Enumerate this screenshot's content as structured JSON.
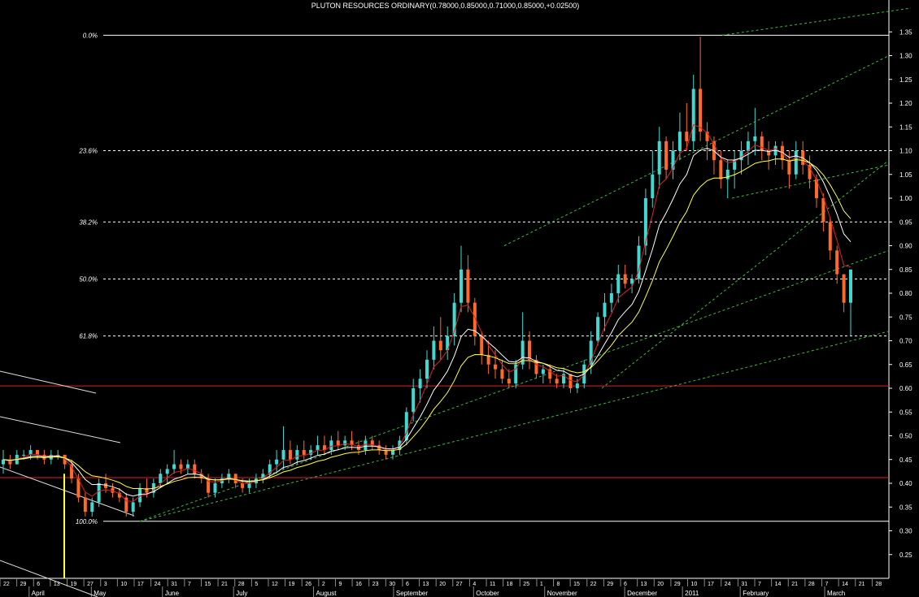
{
  "chart_data": {
    "type": "candlestick",
    "title": "PLUTON RESOURCES  ORDINARY(0.78000,0.85000,0.71000,0.85000,+0.02500)",
    "y_axis": {
      "min": 0.2,
      "max": 1.4,
      "position": "right",
      "ticks": [
        "0.25",
        "0.30",
        "0.35",
        "0.40",
        "0.45",
        "0.50",
        "0.55",
        "0.60",
        "0.65",
        "0.70",
        "0.75",
        "0.80",
        "0.85",
        "0.90",
        "0.95",
        "1.00",
        "1.05",
        "1.10",
        "1.15",
        "1.20",
        "1.25",
        "1.30",
        "1.35"
      ]
    },
    "x_axis": {
      "day_ticks": [
        "22",
        "29",
        "6",
        "13",
        "19",
        "27",
        "3",
        "10",
        "17",
        "24",
        "31",
        "7",
        "15",
        "21",
        "28",
        "5",
        "12",
        "19",
        "26",
        "2",
        "9",
        "16",
        "23",
        "30",
        "6",
        "13",
        "20",
        "27",
        "4",
        "11",
        "18",
        "25",
        "1",
        "8",
        "15",
        "22",
        "29",
        "6",
        "13",
        "20",
        "29",
        "10",
        "17",
        "24",
        "31",
        "7",
        "14",
        "21",
        "28",
        "7",
        "14",
        "21",
        "28"
      ],
      "months": [
        "April",
        "May",
        "June",
        "July",
        "August",
        "September",
        "October",
        "November",
        "December",
        "2011",
        "February",
        "March"
      ]
    },
    "fibonacci": [
      {
        "label": "0.0%",
        "price": 1.343
      },
      {
        "label": "23.6%",
        "price": 1.1
      },
      {
        "label": "38.2%",
        "price": 0.95
      },
      {
        "label": "50.0%",
        "price": 0.83
      },
      {
        "label": "61.8%",
        "price": 0.71
      },
      {
        "label": "100.0%",
        "price": 0.32
      }
    ],
    "horizontal_lines": [
      0.605,
      0.412
    ],
    "bars": [
      [
        0.44,
        0.47,
        0.42,
        0.45
      ],
      [
        0.45,
        0.46,
        0.43,
        0.44
      ],
      [
        0.44,
        0.47,
        0.44,
        0.46
      ],
      [
        0.46,
        0.47,
        0.45,
        0.46
      ],
      [
        0.46,
        0.48,
        0.45,
        0.47
      ],
      [
        0.47,
        0.47,
        0.45,
        0.46
      ],
      [
        0.46,
        0.47,
        0.44,
        0.45
      ],
      [
        0.45,
        0.47,
        0.44,
        0.46
      ],
      [
        0.46,
        0.47,
        0.45,
        0.46
      ],
      [
        0.46,
        0.46,
        0.43,
        0.44
      ],
      [
        0.44,
        0.45,
        0.4,
        0.41
      ],
      [
        0.41,
        0.42,
        0.36,
        0.37
      ],
      [
        0.37,
        0.38,
        0.33,
        0.34
      ],
      [
        0.34,
        0.37,
        0.33,
        0.36
      ],
      [
        0.36,
        0.41,
        0.35,
        0.4
      ],
      [
        0.4,
        0.42,
        0.38,
        0.39
      ],
      [
        0.39,
        0.4,
        0.37,
        0.38
      ],
      [
        0.38,
        0.39,
        0.36,
        0.37
      ],
      [
        0.37,
        0.38,
        0.33,
        0.34
      ],
      [
        0.34,
        0.37,
        0.33,
        0.36
      ],
      [
        0.36,
        0.4,
        0.35,
        0.39
      ],
      [
        0.39,
        0.41,
        0.37,
        0.38
      ],
      [
        0.38,
        0.41,
        0.37,
        0.4
      ],
      [
        0.4,
        0.43,
        0.39,
        0.42
      ],
      [
        0.42,
        0.44,
        0.4,
        0.43
      ],
      [
        0.43,
        0.47,
        0.42,
        0.44
      ],
      [
        0.44,
        0.45,
        0.42,
        0.43
      ],
      [
        0.43,
        0.45,
        0.42,
        0.44
      ],
      [
        0.44,
        0.45,
        0.41,
        0.42
      ],
      [
        0.42,
        0.43,
        0.4,
        0.41
      ],
      [
        0.41,
        0.42,
        0.37,
        0.38
      ],
      [
        0.38,
        0.41,
        0.37,
        0.4
      ],
      [
        0.4,
        0.42,
        0.39,
        0.41
      ],
      [
        0.41,
        0.43,
        0.4,
        0.42
      ],
      [
        0.42,
        0.42,
        0.39,
        0.4
      ],
      [
        0.4,
        0.41,
        0.38,
        0.39
      ],
      [
        0.39,
        0.41,
        0.38,
        0.4
      ],
      [
        0.4,
        0.42,
        0.39,
        0.41
      ],
      [
        0.41,
        0.43,
        0.4,
        0.42
      ],
      [
        0.42,
        0.45,
        0.41,
        0.44
      ],
      [
        0.44,
        0.47,
        0.42,
        0.45
      ],
      [
        0.45,
        0.52,
        0.43,
        0.47
      ],
      [
        0.47,
        0.49,
        0.44,
        0.45
      ],
      [
        0.45,
        0.48,
        0.44,
        0.47
      ],
      [
        0.47,
        0.49,
        0.45,
        0.46
      ],
      [
        0.46,
        0.48,
        0.45,
        0.47
      ],
      [
        0.47,
        0.5,
        0.46,
        0.48
      ],
      [
        0.48,
        0.5,
        0.46,
        0.47
      ],
      [
        0.47,
        0.5,
        0.46,
        0.49
      ],
      [
        0.49,
        0.51,
        0.47,
        0.48
      ],
      [
        0.48,
        0.5,
        0.47,
        0.49
      ],
      [
        0.49,
        0.51,
        0.47,
        0.48
      ],
      [
        0.48,
        0.49,
        0.46,
        0.47
      ],
      [
        0.47,
        0.5,
        0.46,
        0.49
      ],
      [
        0.49,
        0.5,
        0.47,
        0.48
      ],
      [
        0.48,
        0.49,
        0.46,
        0.47
      ],
      [
        0.47,
        0.48,
        0.45,
        0.46
      ],
      [
        0.46,
        0.48,
        0.45,
        0.47
      ],
      [
        0.47,
        0.5,
        0.46,
        0.49
      ],
      [
        0.49,
        0.56,
        0.48,
        0.55
      ],
      [
        0.55,
        0.62,
        0.53,
        0.6
      ],
      [
        0.6,
        0.64,
        0.57,
        0.62
      ],
      [
        0.62,
        0.68,
        0.6,
        0.66
      ],
      [
        0.66,
        0.73,
        0.64,
        0.7
      ],
      [
        0.7,
        0.75,
        0.66,
        0.68
      ],
      [
        0.68,
        0.73,
        0.66,
        0.71
      ],
      [
        0.71,
        0.8,
        0.69,
        0.78
      ],
      [
        0.78,
        0.9,
        0.76,
        0.85
      ],
      [
        0.85,
        0.88,
        0.76,
        0.78
      ],
      [
        0.78,
        0.79,
        0.69,
        0.71
      ],
      [
        0.71,
        0.72,
        0.65,
        0.67
      ],
      [
        0.67,
        0.7,
        0.63,
        0.65
      ],
      [
        0.65,
        0.68,
        0.62,
        0.64
      ],
      [
        0.64,
        0.66,
        0.61,
        0.62
      ],
      [
        0.62,
        0.64,
        0.6,
        0.61
      ],
      [
        0.61,
        0.66,
        0.6,
        0.65
      ],
      [
        0.65,
        0.76,
        0.64,
        0.7
      ],
      [
        0.7,
        0.72,
        0.64,
        0.66
      ],
      [
        0.66,
        0.67,
        0.62,
        0.63
      ],
      [
        0.63,
        0.65,
        0.61,
        0.64
      ],
      [
        0.64,
        0.65,
        0.61,
        0.62
      ],
      [
        0.62,
        0.63,
        0.6,
        0.61
      ],
      [
        0.61,
        0.64,
        0.6,
        0.63
      ],
      [
        0.63,
        0.63,
        0.59,
        0.6
      ],
      [
        0.6,
        0.62,
        0.59,
        0.61
      ],
      [
        0.61,
        0.66,
        0.6,
        0.65
      ],
      [
        0.65,
        0.72,
        0.63,
        0.7
      ],
      [
        0.7,
        0.76,
        0.69,
        0.75
      ],
      [
        0.75,
        0.8,
        0.72,
        0.78
      ],
      [
        0.78,
        0.82,
        0.76,
        0.8
      ],
      [
        0.8,
        0.86,
        0.78,
        0.84
      ],
      [
        0.84,
        0.86,
        0.81,
        0.82
      ],
      [
        0.82,
        0.84,
        0.8,
        0.83
      ],
      [
        0.83,
        0.92,
        0.82,
        0.9
      ],
      [
        0.9,
        1.02,
        0.88,
        1.0
      ],
      [
        1.0,
        1.1,
        0.98,
        1.05
      ],
      [
        1.05,
        1.15,
        1.02,
        1.12
      ],
      [
        1.12,
        1.13,
        1.04,
        1.06
      ],
      [
        1.06,
        1.12,
        1.04,
        1.1
      ],
      [
        1.1,
        1.18,
        1.08,
        1.14
      ],
      [
        1.14,
        1.2,
        1.1,
        1.12
      ],
      [
        1.12,
        1.26,
        1.1,
        1.23
      ],
      [
        1.23,
        1.34,
        1.12,
        1.14
      ],
      [
        1.14,
        1.16,
        1.08,
        1.12
      ],
      [
        1.12,
        1.13,
        1.05,
        1.08
      ],
      [
        1.08,
        1.1,
        1.02,
        1.04
      ],
      [
        1.04,
        1.08,
        1.0,
        1.06
      ],
      [
        1.06,
        1.1,
        1.02,
        1.08
      ],
      [
        1.08,
        1.12,
        1.05,
        1.1
      ],
      [
        1.1,
        1.14,
        1.07,
        1.12
      ],
      [
        1.12,
        1.19,
        1.09,
        1.13
      ],
      [
        1.13,
        1.14,
        1.08,
        1.1
      ],
      [
        1.1,
        1.12,
        1.06,
        1.09
      ],
      [
        1.09,
        1.12,
        1.07,
        1.11
      ],
      [
        1.11,
        1.12,
        1.06,
        1.08
      ],
      [
        1.08,
        1.1,
        1.02,
        1.05
      ],
      [
        1.05,
        1.12,
        1.04,
        1.1
      ],
      [
        1.1,
        1.12,
        1.05,
        1.07
      ],
      [
        1.07,
        1.09,
        1.02,
        1.04
      ],
      [
        1.04,
        1.05,
        0.98,
        1.0
      ],
      [
        1.0,
        1.01,
        0.93,
        0.95
      ],
      [
        0.95,
        0.96,
        0.87,
        0.89
      ],
      [
        0.89,
        0.9,
        0.82,
        0.84
      ],
      [
        0.84,
        0.84,
        0.76,
        0.78
      ],
      [
        0.78,
        0.85,
        0.71,
        0.85
      ]
    ]
  }
}
